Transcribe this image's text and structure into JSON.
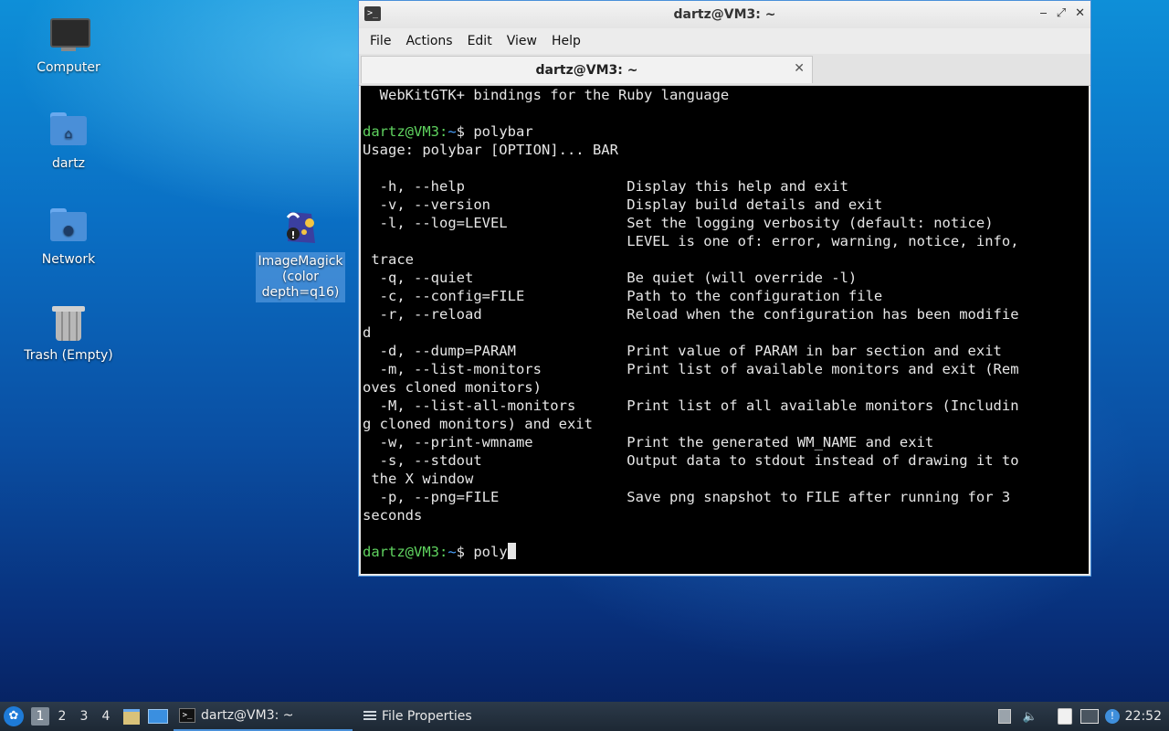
{
  "desktop": {
    "icons": [
      {
        "label": "Computer",
        "icon": "computer-icon"
      },
      {
        "label": "dartz",
        "icon": "home-folder-icon"
      },
      {
        "label": "Network",
        "icon": "network-folder-icon"
      },
      {
        "label": "Trash (Empty)",
        "icon": "trash-icon"
      },
      {
        "label": "ImageMagick (color depth=q16)",
        "icon": "imagemagick-icon",
        "selected": true
      }
    ]
  },
  "window": {
    "title": "dartz@VM3: ~",
    "controls": {
      "minimize": "‒",
      "maximize": "⤢",
      "close": "✕"
    },
    "menu": [
      "File",
      "Actions",
      "Edit",
      "View",
      "Help"
    ],
    "tab": {
      "label": "dartz@VM3: ~",
      "close": "✕"
    },
    "terminal": {
      "prompt_user": "dartz@VM3:",
      "prompt_path": "~",
      "prompt_symbol": "$ ",
      "lines_before": [
        "  WebKitGTK+ bindings for the Ruby language",
        ""
      ],
      "command": "polybar",
      "output": [
        "Usage: polybar [OPTION]... BAR",
        "",
        "  -h, --help                   Display this help and exit",
        "  -v, --version                Display build details and exit",
        "  -l, --log=LEVEL              Set the logging verbosity (default: notice)",
        "                               LEVEL is one of: error, warning, notice, info,",
        " trace",
        "  -q, --quiet                  Be quiet (will override -l)",
        "  -c, --config=FILE            Path to the configuration file",
        "  -r, --reload                 Reload when the configuration has been modifie",
        "d",
        "  -d, --dump=PARAM             Print value of PARAM in bar section and exit",
        "  -m, --list-monitors          Print list of available monitors and exit (Rem",
        "oves cloned monitors)",
        "  -M, --list-all-monitors      Print list of all available monitors (Includin",
        "g cloned monitors) and exit",
        "  -w, --print-wmname           Print the generated WM_NAME and exit",
        "  -s, --stdout                 Output data to stdout instead of drawing it to",
        " the X window",
        "  -p, --png=FILE               Save png snapshot to FILE after running for 3",
        "seconds",
        ""
      ],
      "current_input": "poly"
    }
  },
  "taskbar": {
    "start_icon": "lxqt-menu-icon",
    "workspaces": [
      "1",
      "2",
      "3",
      "4"
    ],
    "active_workspace": "1",
    "quicklaunch": [
      "file-manager-icon",
      "show-desktop-icon"
    ],
    "tasks": [
      {
        "label": "dartz@VM3: ~",
        "icon": "terminal-icon",
        "active": true
      },
      {
        "label": "File Properties",
        "icon": "list-icon",
        "active": false
      }
    ],
    "tray": [
      "removable-drive-icon",
      "volume-icon",
      "clipboard-icon",
      "network-icon",
      "notification-icon"
    ],
    "clock": "22:52"
  }
}
